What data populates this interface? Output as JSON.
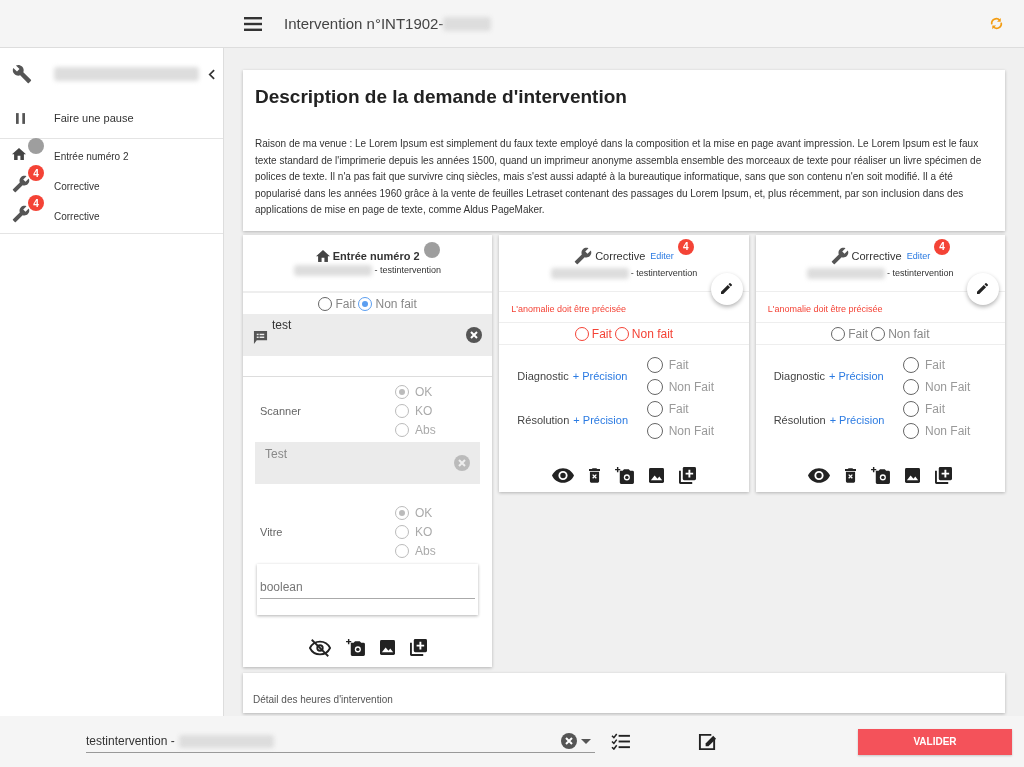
{
  "header": {
    "title": "Intervention n°INT1902-"
  },
  "sidebar": {
    "pause_label": "Faire une pause",
    "items": [
      {
        "kind": "home",
        "label": "Entrée numéro 2"
      },
      {
        "kind": "wrench",
        "label": "Corrective",
        "badge": "4"
      },
      {
        "kind": "wrench",
        "label": "Corrective",
        "badge": "4"
      }
    ]
  },
  "description": {
    "title": "Description de la demande d'intervention",
    "text": "Raison de ma venue : Le Lorem Ipsum est simplement du faux texte employé dans la composition et la mise en page avant impression. Le Lorem Ipsum est le faux texte standard de l'imprimerie depuis les années 1500, quand un imprimeur anonyme assembla ensemble des morceaux de texte pour réaliser un livre spécimen de polices de texte. Il n'a pas fait que survivre cinq siècles, mais s'est aussi adapté à la bureautique informatique, sans que son contenu n'en soit modifié. Il a été popularisé dans les années 1960 grâce à la vente de feuilles Letraset contenant des passages du Lorem Ipsum, et, plus récemment, par son inclusion dans des applications de mise en page de texte, comme Aldus PageMaker."
  },
  "cards": [
    {
      "kind": "entry",
      "title": "Entrée numéro 2",
      "subtitle": "- testintervention",
      "error": false,
      "status": [
        {
          "label": "Fait",
          "selected": false
        },
        {
          "label": "Non fait",
          "selected": true
        }
      ],
      "comment": "test",
      "questions": [
        {
          "label": "Scanner",
          "disabled": true,
          "options": [
            {
              "label": "OK",
              "selected": true
            },
            {
              "label": "KO",
              "selected": false
            },
            {
              "label": "Abs",
              "selected": false
            }
          ],
          "note": "Test"
        },
        {
          "label": "Vitre",
          "disabled": true,
          "options": [
            {
              "label": "OK",
              "selected": true
            },
            {
              "label": "KO",
              "selected": false
            },
            {
              "label": "Abs",
              "selected": false
            }
          ],
          "field": "boolean"
        }
      ],
      "tools": [
        {
          "kind": "eye-off"
        },
        {
          "kind": "camera-add"
        },
        {
          "kind": "image"
        },
        {
          "kind": "library-add"
        }
      ]
    },
    {
      "kind": "corrective",
      "title": "Corrective",
      "link": "Editer",
      "badge": "4",
      "subtitle": "- testintervention",
      "warning": "L'anomalie doit être précisée",
      "error": true,
      "status": [
        {
          "label": "Fait",
          "selected": false
        },
        {
          "label": "Non fait",
          "selected": false
        }
      ],
      "tasks": [
        {
          "label": "Diagnostic",
          "link": "+ Précision",
          "options": [
            {
              "label": "Fait",
              "selected": false
            },
            {
              "label": "Non Fait",
              "selected": false
            }
          ]
        },
        {
          "label": "Résolution",
          "link": "+ Précision",
          "options": [
            {
              "label": "Fait",
              "selected": false
            },
            {
              "label": "Non Fait",
              "selected": false
            }
          ]
        }
      ],
      "tools": [
        {
          "kind": "eye"
        },
        {
          "kind": "delete"
        },
        {
          "kind": "camera-add"
        },
        {
          "kind": "image"
        },
        {
          "kind": "library-add"
        }
      ]
    },
    {
      "kind": "corrective",
      "title": "Corrective",
      "link": "Editer",
      "badge": "4",
      "subtitle": "- testintervention",
      "warning": "L'anomalie doit être précisée",
      "error": false,
      "status": [
        {
          "label": "Fait",
          "selected": false
        },
        {
          "label": "Non fait",
          "selected": false
        }
      ],
      "tasks": [
        {
          "label": "Diagnostic",
          "link": "+ Précision",
          "options": [
            {
              "label": "Fait",
              "selected": false
            },
            {
              "label": "Non Fait",
              "selected": false
            }
          ]
        },
        {
          "label": "Résolution",
          "link": "+ Précision",
          "options": [
            {
              "label": "Fait",
              "selected": false
            },
            {
              "label": "Non Fait",
              "selected": false
            }
          ]
        }
      ],
      "tools": [
        {
          "kind": "eye"
        },
        {
          "kind": "delete"
        },
        {
          "kind": "camera-add"
        },
        {
          "kind": "image"
        },
        {
          "kind": "library-add"
        }
      ]
    }
  ],
  "hours_section": {
    "title": "Détail des heures d'intervention"
  },
  "footer": {
    "select_value": "testintervention -",
    "button": "VALIDER"
  }
}
